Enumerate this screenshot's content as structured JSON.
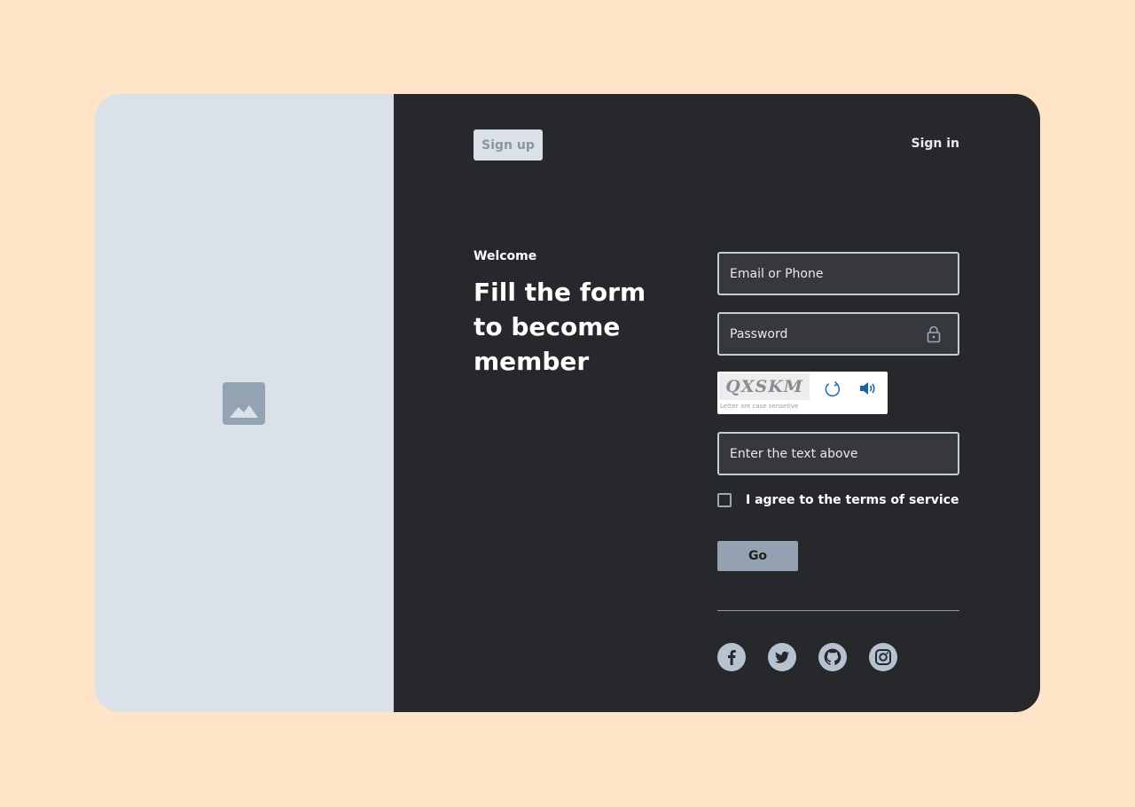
{
  "nav": {
    "signup_label": "Sign up",
    "signin_label": "Sign in"
  },
  "intro": {
    "welcome": "Welcome",
    "headline": "Fill the form to become member"
  },
  "form": {
    "email_placeholder": "Email or Phone",
    "password_placeholder": "Password",
    "captcha_text": "QXSKM",
    "captcha_hint": "Letter are case sensetive",
    "captcha_input_placeholder": "Enter the text above",
    "terms_label": "I agree to the terms of service",
    "submit_label": "Go"
  },
  "social": [
    {
      "icon": "facebook-icon"
    },
    {
      "icon": "twitter-icon"
    },
    {
      "icon": "github-icon"
    },
    {
      "icon": "instagram-icon"
    }
  ],
  "colors": {
    "page_background": "#FFE4C8",
    "left_panel": "#DAE1E9",
    "right_panel": "#27282B",
    "accent_button": "#93A1B1"
  }
}
